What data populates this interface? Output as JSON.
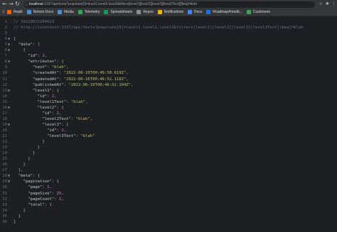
{
  "browser": {
    "url_host": "localhost",
    "url_rest": ":1337/api/tests?populate[0]=level1.level2.level3&filters[level1][level2][level3][level3Text][$eq]=blah",
    "bookmarks": [
      "Replit",
      "Nelson Docs",
      "Media",
      "Telemetry",
      "Spreadsheets",
      "Repos",
      "Notifications",
      "Docs",
      "Roadmap/Feedb...",
      "Customers"
    ]
  },
  "code_lines": [
    [
      {
        "t": "// 20220615204023",
        "c": "comment"
      }
    ],
    [
      {
        "t": "// http://localhost:1337/api/tests?populate[0]=level1.level2.level3&filters[level1][level2][level3][level3Text][$eq]=blah",
        "c": "comment"
      }
    ],
    [],
    [
      {
        "t": "{",
        "c": "punct"
      }
    ],
    [
      {
        "t": "  \"data\"",
        "c": "key"
      },
      {
        "t": ": [",
        "c": "punct"
      }
    ],
    [
      {
        "t": "    {",
        "c": "punct"
      }
    ],
    [
      {
        "t": "      \"id\"",
        "c": "key"
      },
      {
        "t": ": ",
        "c": "punct"
      },
      {
        "t": "2",
        "c": "number"
      },
      {
        "t": ",",
        "c": "punct"
      }
    ],
    [
      {
        "t": "      \"attributes\"",
        "c": "key"
      },
      {
        "t": ": {",
        "c": "punct"
      }
    ],
    [
      {
        "t": "        \"text\"",
        "c": "key"
      },
      {
        "t": ": ",
        "c": "punct"
      },
      {
        "t": "\"blah\"",
        "c": "string"
      },
      {
        "t": ",",
        "c": "punct"
      }
    ],
    [
      {
        "t": "        \"createdAt\"",
        "c": "key"
      },
      {
        "t": ": ",
        "c": "punct"
      },
      {
        "t": "\"2022-06-16T00:46:50.619Z\"",
        "c": "string"
      },
      {
        "t": ",",
        "c": "punct"
      }
    ],
    [
      {
        "t": "        \"updatedAt\"",
        "c": "key"
      },
      {
        "t": ": ",
        "c": "punct"
      },
      {
        "t": "\"2022-06-16T00:46:52.118Z\"",
        "c": "string"
      },
      {
        "t": ",",
        "c": "punct"
      }
    ],
    [
      {
        "t": "        \"publishedAt\"",
        "c": "key"
      },
      {
        "t": ": ",
        "c": "punct"
      },
      {
        "t": "\"2022-06-16T00:46:52.104Z\"",
        "c": "string"
      },
      {
        "t": ",",
        "c": "punct"
      }
    ],
    [
      {
        "t": "        \"level1\"",
        "c": "key"
      },
      {
        "t": ": {",
        "c": "punct"
      }
    ],
    [
      {
        "t": "          \"id\"",
        "c": "key"
      },
      {
        "t": ": ",
        "c": "punct"
      },
      {
        "t": "2",
        "c": "number"
      },
      {
        "t": ",",
        "c": "punct"
      }
    ],
    [
      {
        "t": "          \"level1Text\"",
        "c": "key"
      },
      {
        "t": ": ",
        "c": "punct"
      },
      {
        "t": "\"blah\"",
        "c": "string"
      },
      {
        "t": ",",
        "c": "punct"
      }
    ],
    [
      {
        "t": "          \"level2\"",
        "c": "key"
      },
      {
        "t": ": {",
        "c": "punct"
      }
    ],
    [
      {
        "t": "            \"id\"",
        "c": "key"
      },
      {
        "t": ": ",
        "c": "punct"
      },
      {
        "t": "2",
        "c": "number"
      },
      {
        "t": ",",
        "c": "punct"
      }
    ],
    [
      {
        "t": "            \"level2Text\"",
        "c": "key"
      },
      {
        "t": ": ",
        "c": "punct"
      },
      {
        "t": "\"blah\"",
        "c": "string"
      },
      {
        "t": ",",
        "c": "punct"
      }
    ],
    [
      {
        "t": "            \"level3\"",
        "c": "key"
      },
      {
        "t": ": {",
        "c": "punct"
      }
    ],
    [
      {
        "t": "              \"id\"",
        "c": "key"
      },
      {
        "t": ": ",
        "c": "punct"
      },
      {
        "t": "2",
        "c": "number"
      },
      {
        "t": ",",
        "c": "punct"
      }
    ],
    [
      {
        "t": "              \"level3Text\"",
        "c": "key"
      },
      {
        "t": ": ",
        "c": "punct"
      },
      {
        "t": "\"blah\"",
        "c": "string"
      }
    ],
    [
      {
        "t": "            }",
        "c": "punct"
      }
    ],
    [
      {
        "t": "          }",
        "c": "punct"
      }
    ],
    [
      {
        "t": "        }",
        "c": "punct"
      }
    ],
    [
      {
        "t": "      }",
        "c": "punct"
      }
    ],
    [
      {
        "t": "    }",
        "c": "punct"
      }
    ],
    [
      {
        "t": "  ],",
        "c": "punct"
      }
    ],
    [
      {
        "t": "  \"meta\"",
        "c": "key"
      },
      {
        "t": ": {",
        "c": "punct"
      }
    ],
    [
      {
        "t": "    \"pagination\"",
        "c": "key"
      },
      {
        "t": ": {",
        "c": "punct"
      }
    ],
    [
      {
        "t": "      \"page\"",
        "c": "key"
      },
      {
        "t": ": ",
        "c": "punct"
      },
      {
        "t": "1",
        "c": "number"
      },
      {
        "t": ",",
        "c": "punct"
      }
    ],
    [
      {
        "t": "      \"pageSize\"",
        "c": "key"
      },
      {
        "t": ": ",
        "c": "punct"
      },
      {
        "t": "25",
        "c": "number"
      },
      {
        "t": ",",
        "c": "punct"
      }
    ],
    [
      {
        "t": "      \"pageCount\"",
        "c": "key"
      },
      {
        "t": ": ",
        "c": "punct"
      },
      {
        "t": "1",
        "c": "number"
      },
      {
        "t": ",",
        "c": "punct"
      }
    ],
    [
      {
        "t": "      \"total\"",
        "c": "key"
      },
      {
        "t": ": ",
        "c": "punct"
      },
      {
        "t": "1",
        "c": "number"
      }
    ],
    [
      {
        "t": "    }",
        "c": "punct"
      }
    ],
    [
      {
        "t": "  }",
        "c": "punct"
      }
    ],
    [
      {
        "t": "}",
        "c": "punct"
      }
    ]
  ],
  "fold_lines": [
    4,
    5,
    6,
    8,
    13,
    16,
    19,
    28,
    29
  ],
  "colors": {
    "background": "#1e1f22",
    "comment": "#6c7280",
    "string": "#bdbf6a",
    "number": "#d07cc9"
  },
  "icons": {
    "back": "back-arrow-icon",
    "forward": "forward-arrow-icon",
    "reload": "reload-icon",
    "bookmark_star": "star-icon",
    "extensions": "puzzle-icon",
    "menu": "more-vert-icon"
  }
}
